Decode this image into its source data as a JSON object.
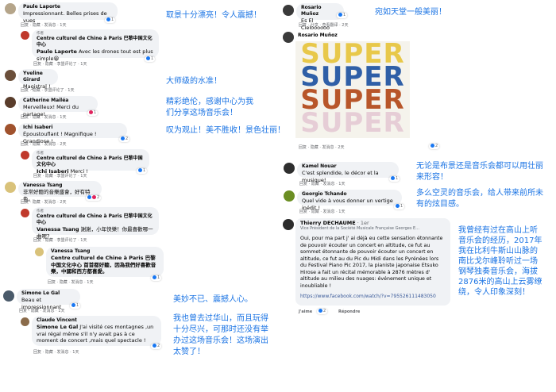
{
  "left": {
    "c1": {
      "name": "Paule Laporte",
      "text": "Impressionnant. Belles prises de vues",
      "actions": "回复 · 隐藏 · 发消息 · 1天",
      "count": "1"
    },
    "r1": {
      "author_tag": "作者",
      "name": "Centre culturel de Chine à Paris 巴黎中国文化中心",
      "mention": "Paule Laporte",
      "text": " Avec les drones tout est plus simple😀",
      "actions": "回复 · 隐藏 · 李盟评论了 · 1天",
      "count": "1"
    },
    "c2": {
      "name": "Yveline Girard",
      "text": "Magistral !",
      "actions": "回复 · 隐藏 · 李盟评论了 · 1天"
    },
    "c3": {
      "name": "Catherine Mailéa",
      "text": "Merveilleux! Merci du partage!",
      "actions": "回复 · 隐藏 · 发消息 · 1天",
      "count": "1"
    },
    "c4": {
      "name": "Ichi Isaberi",
      "text": "Époustouflant !   Magnifique !   Grandiose !",
      "actions": "回复 · 隐藏 · 发消息 · 2天",
      "count": "2"
    },
    "r4": {
      "author_tag": "作者",
      "name": "Centre culturel de Chine à Paris 巴黎中国文化中心",
      "mention": "Ichi Isaberi",
      "text": " Merci !",
      "actions": "回复 · 隐藏 · 李盟评论了 · 1天",
      "count": "1"
    },
    "c5": {
      "name": "Vanessa Tsang",
      "text": "非常好聽的音樂盛會，好有特色。",
      "actions": "回复 · 隐藏 · 发消息 · 2天",
      "count": "2"
    },
    "r5a": {
      "author_tag": "作者",
      "name": "Centre culturel de Chine à Paris 巴黎中国文化中心",
      "mention": "Vanessa Tsang",
      "text": " 謝謝，小年快樂！你最喜歡哪一曲呢？",
      "actions": "回复 · 隐藏 · 李盟评论了 · 1天"
    },
    "r5b": {
      "name": "Vanessa Tsang",
      "text": "Centre culturel de Chine à Paris 巴黎中国文化中心 首首都好聽，因為我們好喜歡音樂，中國和西方都喜愛。",
      "actions": "回复 · 隐藏 · 发消息 · 1天",
      "count": "1"
    },
    "c6": {
      "name": "Simone Le Gal",
      "text": "Beau et impressionnant",
      "actions": "回复 · 隐藏 · 发消息 · 1天",
      "count": "1"
    },
    "c7": {
      "name": "Claude Vincent",
      "mention": "Simone Le Gal",
      "text": " J'ai visité ces montagnes ,un vrai régal même s'il n'y avait pas à ce moment de concert ,mais quel spectacle !",
      "actions": "回复 · 隐藏 · 发消息 · 1天",
      "count": "2"
    }
  },
  "right": {
    "c1": {
      "name": "Rosario Muñoz",
      "text": "Es El Cieloooooo",
      "actions": "回复 · 分享 · 查看翻译 · 2天",
      "count": "1"
    },
    "c2": {
      "name": "Rosario Muñoz",
      "super": "SUPER",
      "actions": "回复 · 隐藏 · 发消息 · 2天",
      "count": "2"
    },
    "c3": {
      "name": "Kamel Nouar",
      "text": "C'est splendide, le décor et la musique!",
      "actions": "回复 · 隐藏 · 发消息 · 1天",
      "count": "1"
    },
    "c4": {
      "name": "Georgio Tchando",
      "text": "Quel vide à vous donner un vertige inédit !",
      "actions": "回复 · 隐藏 · 发消息 · 1天",
      "count": "1"
    },
    "c5": {
      "name": "Thierry DECHAUME",
      "meta": " · 1er",
      "subtitle": "Vice Président de la Société Musicale Française Georges E...",
      "text": "Oui, pour ma part j' ai déjà eu cette sensation étonnante de pouvoir écouter un concert en altitude, ce fut au sommet étonnante de pouvoir écouter un concert en altitude, ce fut au du Pic du Midi dans les Pyrénées lors du Festival Piano Pic 2017, la pianiste japonaise Etsuko Hirose a fait un récital mémorable à 2876 mètres d' altitude au milieu  des nuages: événement unique et inoubliable !",
      "link": "https://www.facebook.com/watch/?v=795526111483050",
      "actions_like": "J'aime",
      "actions_reply": "Répondre",
      "count": "2"
    }
  },
  "translations": {
    "t1": "取景十分漂亮！令人震撼！",
    "t2": "大师级的水准！",
    "t3a": "精彩绝伦，感谢中心为我",
    "t3b": "们分享这场音乐会！",
    "t4": "叹为观止！美不胜收！景色壮丽！",
    "t5": "宛如天堂一般美丽！",
    "t6a": "无论是布景还是音乐会都可以用壮丽",
    "t6b": "来形容！",
    "t7a": "多么空灵的音乐会，给人带来前所未",
    "t7b": "有的炫目感。",
    "t8a": "我曾经有过在高山上听",
    "t8b": "音乐会的经历，2017年",
    "t8c": "我在比利牛斯山山脉的",
    "t8d": "南比戈尔峰聆听过一场",
    "t8e": "钢琴独奏音乐会，海拔",
    "t8f": "2876米的高山上云雾缭",
    "t8g": "绕，令人印象深刻！",
    "t9": "美妙不已、震撼人心。",
    "t10a": "我也曾去过华山，而且玩得",
    "t10b": "十分尽兴，可那时还没有举",
    "t10c": "办过这场音乐会！这场演出",
    "t10d": "太赞了！"
  },
  "colors": {
    "translation": "#1b74e4",
    "bubble": "#f0f2f5",
    "super1": "#e8c84a",
    "super2": "#2f5fa7",
    "super3": "#b8562a",
    "super4": "#e6cdd6"
  }
}
